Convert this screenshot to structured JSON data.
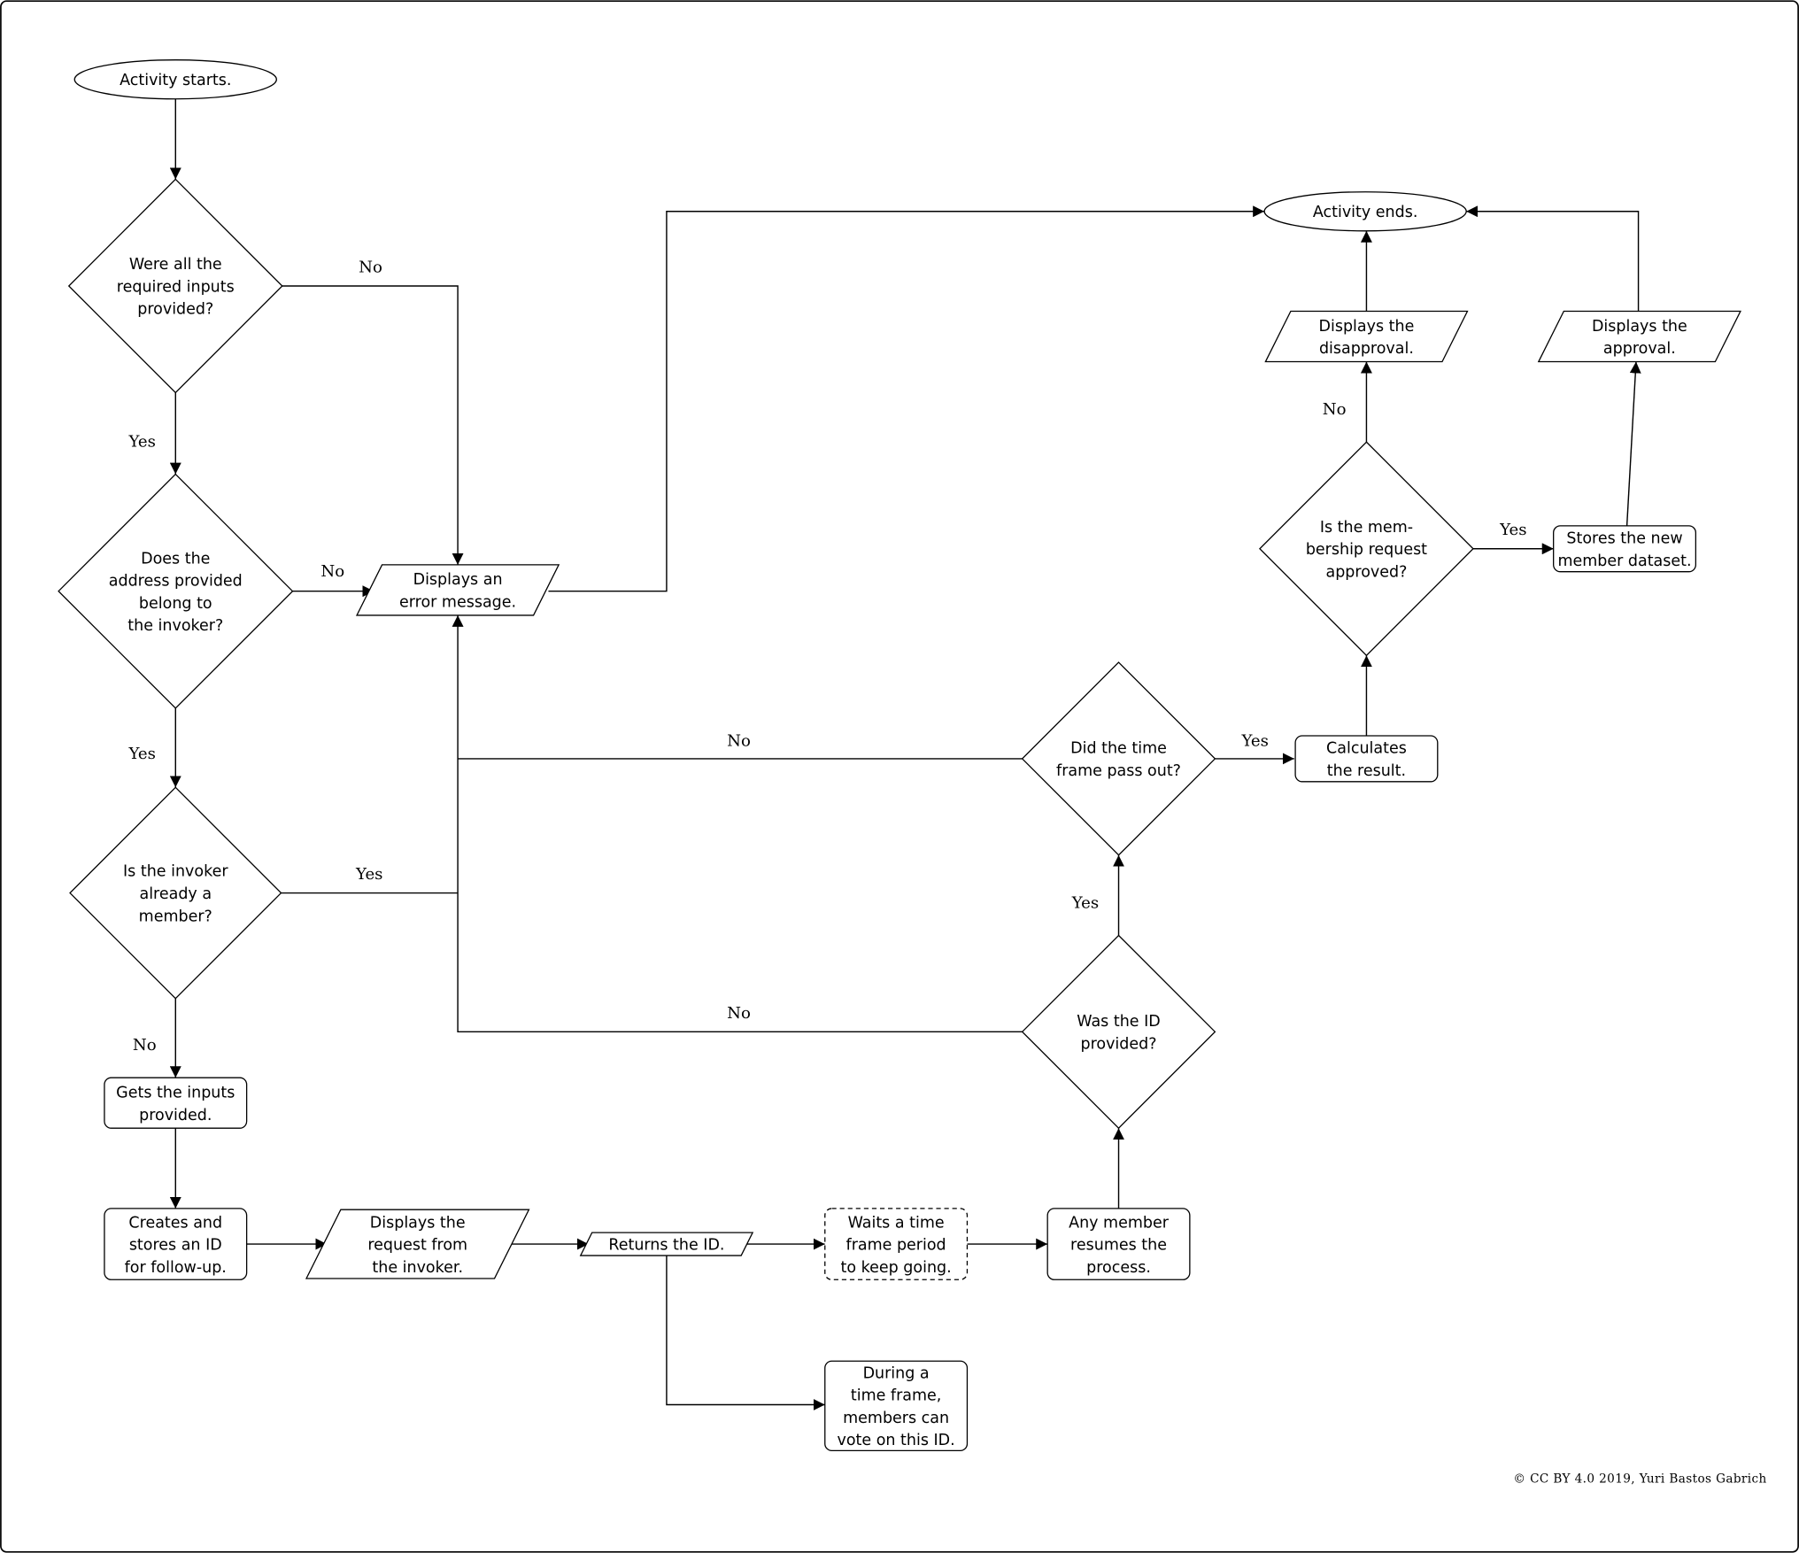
{
  "diagram": {
    "type": "flowchart",
    "nodes": [
      {
        "id": "start",
        "shape": "terminal",
        "lines": [
          "Activity starts."
        ]
      },
      {
        "id": "q_inputs",
        "shape": "decision",
        "lines": [
          "Were all the",
          "required inputs",
          "provided?"
        ]
      },
      {
        "id": "q_address",
        "shape": "decision",
        "lines": [
          "Does the",
          "address provided",
          "belong to",
          "the invoker?"
        ]
      },
      {
        "id": "error",
        "shape": "io",
        "lines": [
          "Displays an",
          "error message."
        ]
      },
      {
        "id": "q_member",
        "shape": "decision",
        "lines": [
          "Is the invoker",
          "already a",
          "member?"
        ]
      },
      {
        "id": "get_inputs",
        "shape": "process",
        "lines": [
          "Gets the inputs",
          "provided."
        ]
      },
      {
        "id": "create_id",
        "shape": "process",
        "lines": [
          "Creates and",
          "stores an ID",
          "for follow-up."
        ]
      },
      {
        "id": "display_request",
        "shape": "io",
        "lines": [
          "Displays the",
          "request from",
          "the invoker."
        ]
      },
      {
        "id": "return_id",
        "shape": "io",
        "lines": [
          "Returns the ID."
        ]
      },
      {
        "id": "wait",
        "shape": "process-dashed",
        "lines": [
          "Waits a time",
          "frame period",
          "to keep going."
        ]
      },
      {
        "id": "vote",
        "shape": "process",
        "lines": [
          "During a",
          "time frame,",
          "members can",
          "vote on this ID."
        ]
      },
      {
        "id": "resume",
        "shape": "process",
        "lines": [
          "Any member",
          "resumes the",
          "process."
        ]
      },
      {
        "id": "q_id",
        "shape": "decision",
        "lines": [
          "Was the ID",
          "provided?"
        ]
      },
      {
        "id": "q_time",
        "shape": "decision",
        "lines": [
          "Did the time",
          "frame pass out?"
        ]
      },
      {
        "id": "calc",
        "shape": "process",
        "lines": [
          "Calculates",
          "the result."
        ]
      },
      {
        "id": "q_approved",
        "shape": "decision",
        "lines": [
          "Is the mem-",
          "bership request",
          "approved?"
        ]
      },
      {
        "id": "disapproval",
        "shape": "io",
        "lines": [
          "Displays the",
          "disapproval."
        ]
      },
      {
        "id": "store",
        "shape": "process",
        "lines": [
          "Stores the new",
          "member dataset."
        ]
      },
      {
        "id": "approval",
        "shape": "io",
        "lines": [
          "Displays the",
          "approval."
        ]
      },
      {
        "id": "end",
        "shape": "terminal",
        "lines": [
          "Activity ends."
        ]
      }
    ],
    "edges": [
      {
        "from": "start",
        "to": "q_inputs",
        "label": ""
      },
      {
        "from": "q_inputs",
        "to": "error",
        "label": "No"
      },
      {
        "from": "q_inputs",
        "to": "q_address",
        "label": "Yes"
      },
      {
        "from": "q_address",
        "to": "error",
        "label": "No"
      },
      {
        "from": "q_address",
        "to": "q_member",
        "label": "Yes"
      },
      {
        "from": "q_member",
        "to": "error",
        "label": "Yes"
      },
      {
        "from": "q_member",
        "to": "get_inputs",
        "label": "No"
      },
      {
        "from": "get_inputs",
        "to": "create_id",
        "label": ""
      },
      {
        "from": "create_id",
        "to": "display_request",
        "label": ""
      },
      {
        "from": "display_request",
        "to": "return_id",
        "label": ""
      },
      {
        "from": "return_id",
        "to": "wait",
        "label": ""
      },
      {
        "from": "return_id",
        "to": "vote",
        "label": ""
      },
      {
        "from": "wait",
        "to": "resume",
        "label": ""
      },
      {
        "from": "resume",
        "to": "q_id",
        "label": ""
      },
      {
        "from": "q_id",
        "to": "q_time",
        "label": "Yes"
      },
      {
        "from": "q_id",
        "to": "error",
        "label": "No"
      },
      {
        "from": "q_time",
        "to": "calc",
        "label": "Yes"
      },
      {
        "from": "q_time",
        "to": "error",
        "label": "No"
      },
      {
        "from": "calc",
        "to": "q_approved",
        "label": ""
      },
      {
        "from": "q_approved",
        "to": "disapproval",
        "label": "No"
      },
      {
        "from": "q_approved",
        "to": "store",
        "label": "Yes"
      },
      {
        "from": "store",
        "to": "approval",
        "label": ""
      },
      {
        "from": "disapproval",
        "to": "end",
        "label": ""
      },
      {
        "from": "approval",
        "to": "end",
        "label": ""
      },
      {
        "from": "error",
        "to": "end",
        "label": ""
      }
    ]
  },
  "credit": "© CC BY 4.0 2019, Yuri Bastos Gabrich"
}
